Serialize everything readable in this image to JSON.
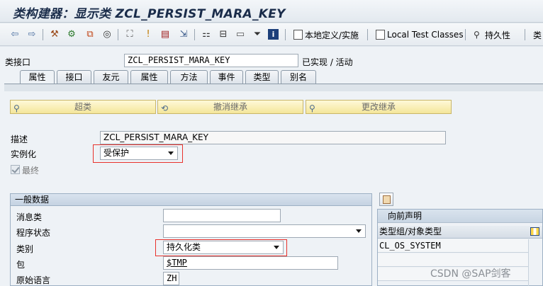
{
  "window": {
    "title": "类构建器：显示类 ZCL_PERSIST_MARA_KEY"
  },
  "toolbar": {
    "icons": [
      "back-arrow-icon",
      "forward-arrow-icon",
      "check-icon",
      "activate-icon",
      "test-icon",
      "where-used-icon",
      "display-object-list-icon",
      "inherit-icon",
      "window-icon",
      "navigate-icon",
      "hierarchy-icon",
      "print-icon",
      "doc-icon",
      "filter-icon",
      "info-icon"
    ],
    "local_def_label": "本地定义/实施",
    "local_test_label": "Local Test Classes",
    "persistence_label": "持久性",
    "more_label": "类"
  },
  "header": {
    "class_interface_label": "类接口",
    "class_name": "ZCL_PERSIST_MARA_KEY",
    "status": "已实现 / 活动"
  },
  "tabs": [
    {
      "label": "属性",
      "active": true
    },
    {
      "label": "接口",
      "active": false
    },
    {
      "label": "友元",
      "active": false
    },
    {
      "label": "属性",
      "active": false
    },
    {
      "label": "方法",
      "active": false
    },
    {
      "label": "事件",
      "active": false
    },
    {
      "label": "类型",
      "active": false
    },
    {
      "label": "别名",
      "active": false
    }
  ],
  "inherit_buttons": {
    "superclass": "超类",
    "undo_inherit": "撤消继承",
    "change_inherit": "更改继承"
  },
  "attributes": {
    "desc_label": "描述",
    "desc_value": "ZCL_PERSIST_MARA_KEY",
    "instantiation_label": "实例化",
    "instantiation_value": "受保护",
    "final_label": "最终",
    "final_checked": true
  },
  "general": {
    "title": "一般数据",
    "msg_class_label": "消息类",
    "msg_class_value": "",
    "program_status_label": "程序状态",
    "program_status_value": "",
    "category_label": "类别",
    "category_value": "持久化类",
    "package_label": "包",
    "package_value": "$TMP",
    "orig_lang_label": "原始语言",
    "orig_lang_value": "ZH"
  },
  "forward": {
    "title": "向前声明",
    "column": "类型组/对象类型",
    "rows": [
      "CL_OS_SYSTEM"
    ]
  },
  "watermark": "CSDN @SAP剑客",
  "colors": {
    "highlight_border": "#e8322c",
    "button_yellow": "#f4e69a"
  }
}
